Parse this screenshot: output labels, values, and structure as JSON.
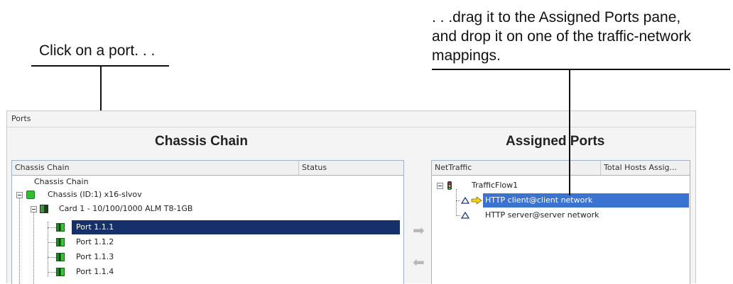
{
  "callouts": {
    "left_text": "Click on a port. . .",
    "right_lines": [
      ". . .drag it to the Assigned Ports pane,",
      "and drop it on one of the traffic-network",
      "mappings."
    ]
  },
  "panel": {
    "label": "Ports",
    "left_title": "Chassis Chain",
    "right_title": "Assigned Ports"
  },
  "chassis_grid": {
    "columns": [
      "Chassis Chain",
      "Status"
    ],
    "root_label": "Chassis Chain",
    "chassis_label": "Chassis (ID:1) x16-slvov",
    "card_label": "Card 1 - 10/100/1000 ALM T8-1GB",
    "ports": [
      "Port 1.1.1",
      "Port 1.1.2",
      "Port 1.1.3",
      "Port 1.1.4"
    ],
    "selected_port": "Port 1.1.1"
  },
  "assigned_grid": {
    "columns": [
      "NetTraffic",
      "Total Hosts Assig..."
    ],
    "flow_label": "TrafficFlow1",
    "mappings": [
      "HTTP client@client network",
      "HTTP server@server network"
    ],
    "highlighted_mapping": "HTTP client@client network"
  },
  "buttons": {
    "assign_arrow": "➡",
    "unassign_arrow": "⬅"
  },
  "icons": {
    "chassis": "chassis-icon",
    "card": "card-icon",
    "port": "port-icon",
    "flow": "traffic-flow-icon",
    "network": "network-icon",
    "drop_target": "drop-arrow-icon"
  },
  "colors": {
    "selection_dark": "#16306a",
    "selection_blue": "#3a74d0",
    "port_green": "#2fbf2f"
  }
}
